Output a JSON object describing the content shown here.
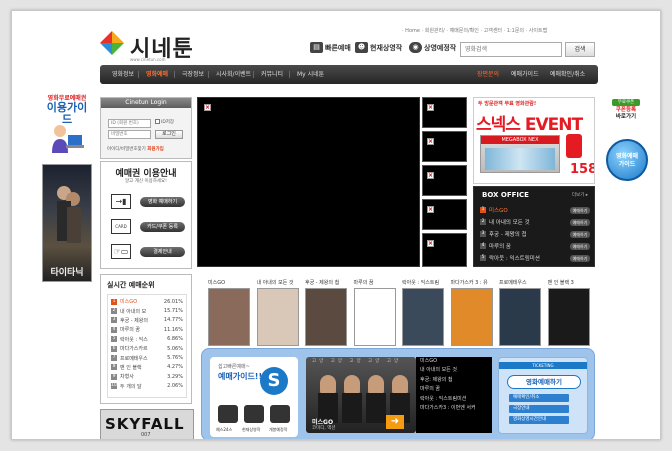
{
  "header": {
    "logo_text": "시네툰",
    "logo_url_text": "www.cinetun.com",
    "utility_links": "· Home · 회원관리/ · 예매문의/확인 · 고객센터 · 1:1문의 · 사이트맵",
    "quick_links": [
      "빠른예매",
      "현재상영작",
      "상영예정작"
    ],
    "search_placeholder": "영화검색",
    "search_button": "검색"
  },
  "nav": {
    "items": [
      "영화정보",
      "영화예매",
      "극장정보",
      "시사회/이벤트",
      "커뮤니티",
      "My 시네툰"
    ],
    "right_items": [
      "장편문의",
      "예매가이드",
      "예매확인/취소"
    ],
    "active_index": 1
  },
  "left_ad": {
    "line1": "영화무료예매권",
    "line2": "이용가이드"
  },
  "left_banner": {
    "titanic": "타이타닉",
    "skyfall": "SKYFALL",
    "skyfall_sub": "007"
  },
  "login": {
    "title": "Cinetun Login",
    "id_placeholder": "ID (회원 번호)",
    "pw_placeholder": "비밀번호",
    "save_id": "ID저장",
    "login_button": "로그인",
    "links": "아이디/비밀번호찾기",
    "join": "회원가입"
  },
  "ticket_guide": {
    "title": "예매권 이용안내",
    "subtitle": "알고 계신 이용하세요!",
    "buttons": [
      "영화 예매하기",
      "카드/쿠폰 등록",
      "결제안내"
    ]
  },
  "realtime_rank": {
    "title": "실시간 예매순위",
    "rows": [
      {
        "rank": "1",
        "title": "미스GO",
        "rate": "26.01%"
      },
      {
        "rank": "2",
        "title": "내 아내의 모",
        "rate": "15.71%"
      },
      {
        "rank": "3",
        "title": "후궁 - 제왕의",
        "rate": "14.77%"
      },
      {
        "rank": "4",
        "title": "마루의 꿈",
        "rate": "11.16%"
      },
      {
        "rank": "5",
        "title": "락아웃 : 익스",
        "rate": "6.86%"
      },
      {
        "rank": "6",
        "title": "마다가스카르",
        "rate": "5.06%"
      },
      {
        "rank": "7",
        "title": "프로메테우스",
        "rate": "5.76%"
      },
      {
        "rank": "8",
        "title": "맨 인 블랙",
        "rate": "4.27%"
      },
      {
        "rank": "9",
        "title": "차형사",
        "rate": "3.29%"
      },
      {
        "rank": "10",
        "title": "두 개의 달",
        "rate": "2.06%"
      }
    ]
  },
  "event_banner": {
    "top_text": "두 방문관객 무료 영화관람!",
    "main_text": "스넥스 EVENT",
    "sign": "MEGABOX NEX",
    "number": "158"
  },
  "box_office": {
    "title": "BOX OFFICE",
    "more": "더보기 ▸",
    "button_label": "예매하기",
    "rows": [
      {
        "rank": "1",
        "title": "미스GO"
      },
      {
        "rank": "2",
        "title": "내 아내의 모든 것"
      },
      {
        "rank": "3",
        "title": "후궁 - 제왕의 첩"
      },
      {
        "rank": "4",
        "title": "마루의 꿈"
      },
      {
        "rank": "5",
        "title": "락아웃 : 익스트림미션"
      }
    ]
  },
  "side_widgets": {
    "coupon": [
      "무료쿠폰",
      "쿠폰등록",
      "바로가기"
    ],
    "guide": [
      "영화예매",
      "가이드"
    ]
  },
  "posters": {
    "labels": [
      "미스GO",
      "내 아내의 모든 것",
      "후궁 - 제왕의 첩",
      "마루의 꿈",
      "락아웃 : 익스트림",
      "마다가스카 3 : 유",
      "프로메테우스",
      "맨 인 블랙 3"
    ],
    "colors": [
      "#8a6a5a",
      "#d9c8b8",
      "#5a4a40",
      "#ffffff",
      "#3a4a5a",
      "#e08a2a",
      "#2a3a4a",
      "#1a1a1a"
    ]
  },
  "guide_panel": {
    "sub": "쉽고빠른예매~",
    "title": "예매가이드!!",
    "icon_labels": [
      "예스24스",
      "현재상영작",
      "개봉예정작"
    ],
    "photo_head": "고양 고양 고양 고양 고양",
    "photo_title": "미스GO",
    "photo_genre": "코미디, 액션",
    "list": [
      "미스GO",
      "내 아내의 모든 것",
      "후궁: 제왕의 첩",
      "마루의 꿈",
      "락아웃 : 익스트림미션",
      "마다가스카3 : 이번엔 서커"
    ],
    "ticket_header": "TICKETING",
    "ticket_main": "영화예매하기",
    "ticket_buttons": [
      "예매확인/취소",
      "극장안내",
      "영화상영시간안내"
    ]
  }
}
